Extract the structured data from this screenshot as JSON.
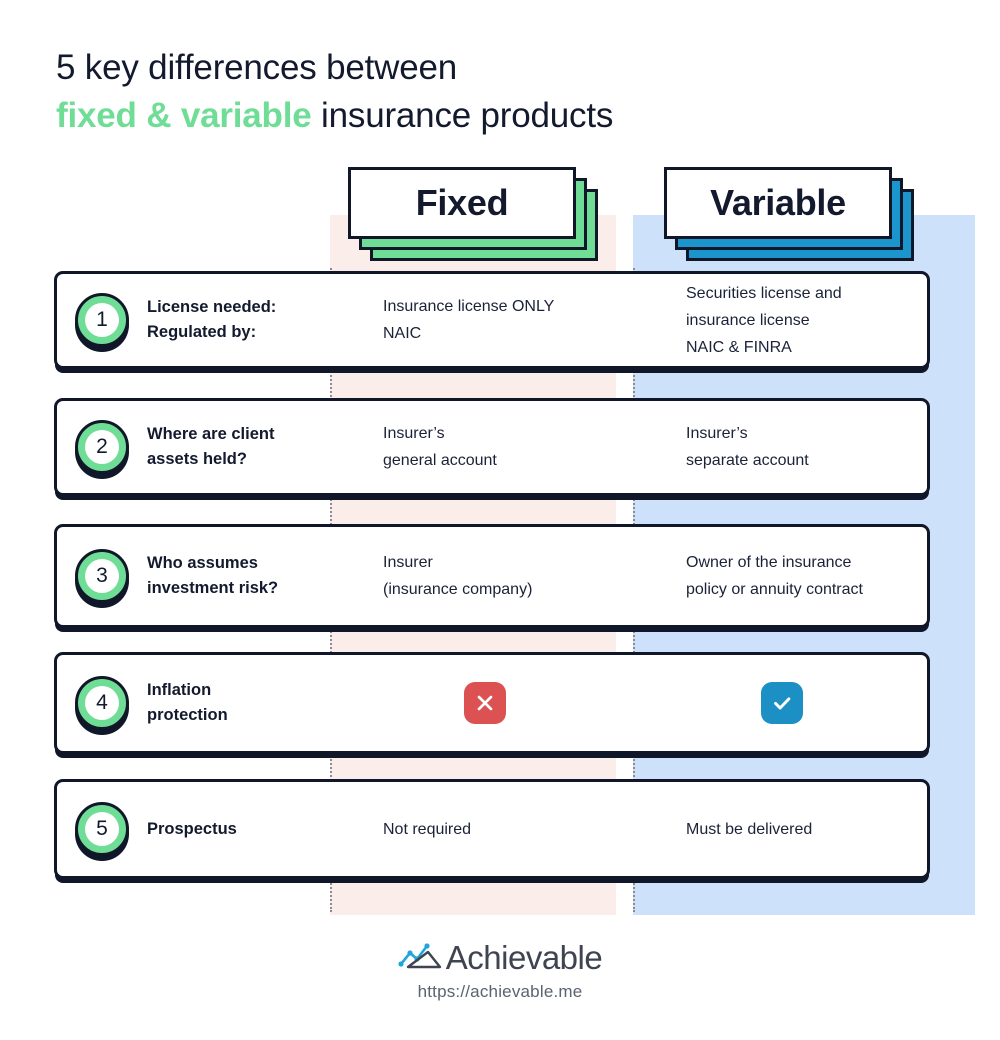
{
  "title": {
    "line1": "5 key differences between",
    "line2_accent": "fixed & variable",
    "line2_rest": " insurance products"
  },
  "columns": {
    "fixed": {
      "label": "Fixed",
      "accent_color": "#6FDD96",
      "band_color": "#FBEDE9"
    },
    "variable": {
      "label": "Variable",
      "accent_color": "#1C94CC",
      "band_color": "#CDE1FB"
    }
  },
  "rows": [
    {
      "number": "1",
      "label_line1": "License needed:",
      "label_line2": "Regulated by:",
      "fixed_line1": "Insurance license ONLY",
      "fixed_line2": "NAIC",
      "fixed_line3": "",
      "variable_line1": "Securities license and",
      "variable_line2": "insurance license",
      "variable_line3": "NAIC & FINRA"
    },
    {
      "number": "2",
      "label_line1": "Where are client",
      "label_line2": "assets held?",
      "fixed_line1": "Insurer’s",
      "fixed_line2": "general account",
      "fixed_line3": "",
      "variable_line1": "Insurer’s",
      "variable_line2": "separate account",
      "variable_line3": ""
    },
    {
      "number": "3",
      "label_line1": "Who assumes",
      "label_line2": "investment risk?",
      "fixed_line1": "Insurer",
      "fixed_line2": "(insurance company)",
      "fixed_line3": "",
      "variable_line1": "Owner of the insurance",
      "variable_line2": "policy or annuity contract",
      "variable_line3": ""
    },
    {
      "number": "4",
      "label_line1": "Inflation",
      "label_line2": "protection",
      "fixed_icon": "close-icon",
      "variable_icon": "check-icon",
      "fixed_icon_color": "#DC5252",
      "variable_icon_color": "#1C8FC4"
    },
    {
      "number": "5",
      "label_line1": "Prospectus",
      "label_line2": "",
      "fixed_line1": "Not required",
      "fixed_line2": "",
      "fixed_line3": "",
      "variable_line1": "Must be delivered",
      "variable_line2": "",
      "variable_line3": ""
    }
  ],
  "footer": {
    "logo_icon": "achievable-chart-logo-icon",
    "brand_name": "Achievable",
    "url": "https://achievable.me"
  }
}
